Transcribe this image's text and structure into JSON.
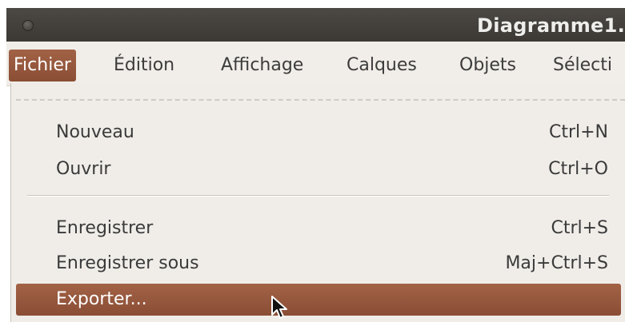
{
  "window": {
    "title": "Diagramme1."
  },
  "menubar": {
    "items": [
      {
        "label": "Fichier"
      },
      {
        "label": "Édition"
      },
      {
        "label": "Affichage"
      },
      {
        "label": "Calques"
      },
      {
        "label": "Objets"
      },
      {
        "label": "Sélecti"
      }
    ]
  },
  "menu": {
    "items": [
      {
        "label": "Nouveau",
        "accel": "Ctrl+N"
      },
      {
        "label": "Ouvrir",
        "accel": "Ctrl+O"
      },
      {
        "label": "Enregistrer",
        "accel": "Ctrl+S"
      },
      {
        "label": "Enregistrer sous",
        "accel": "Maj+Ctrl+S"
      },
      {
        "label": "Exporter...",
        "accel": ""
      }
    ]
  },
  "colors": {
    "titlebar": "#46423d",
    "highlight": "#9a5a3f",
    "menu_bg": "#f0ede9"
  },
  "icons": {
    "window_button": "circle",
    "cursor": "mouse-pointer"
  }
}
